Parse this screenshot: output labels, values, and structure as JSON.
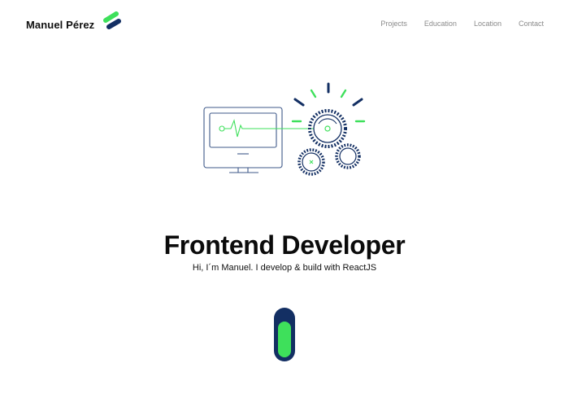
{
  "header": {
    "brand_name": "Manuel Pérez",
    "logo_icon": "stacked-bars-logo",
    "nav": [
      {
        "label": "Projects"
      },
      {
        "label": "Education"
      },
      {
        "label": "Location"
      },
      {
        "label": "Contact"
      }
    ]
  },
  "hero": {
    "illustration_icon": "monitor-gears-illustration",
    "title": "Frontend Developer",
    "subtitle": "Hi, I´m Manuel. I develop & build with ReactJS"
  },
  "scroll_indicator": {
    "icon": "scroll-toggle-icon"
  },
  "colors": {
    "accent_green": "#3ee05b",
    "navy": "#132f63",
    "outline_blue": "#3f5a8a",
    "nav_text": "#8a8a8a"
  }
}
